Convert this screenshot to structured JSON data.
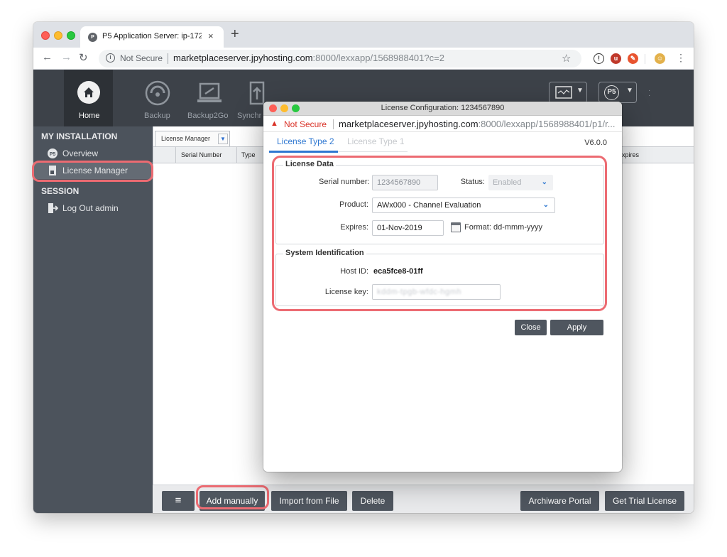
{
  "browser": {
    "tab_title": "P5 Application Server: ip-172-3",
    "tab_close": "×",
    "new_tab": "+",
    "security_label": "Not Secure",
    "url_host": "marketplaceserver.jpyhosting.com",
    "url_rest": ":8000/lexxapp/1568988401?c=2"
  },
  "header": {
    "home_label": "Home",
    "nav_items": [
      "Backup",
      "Backup2Go",
      "Synchr"
    ],
    "p5_label": "P5"
  },
  "sidebar": {
    "section_installation": "MY INSTALLATION",
    "overview_label": "Overview",
    "license_manager_label": "License Manager",
    "section_session": "SESSION",
    "logout_label": "Log Out admin"
  },
  "license_manager": {
    "tab_label": "License Manager",
    "columns": [
      "Serial Number",
      "Type",
      "xpires"
    ]
  },
  "bottom_bar": {
    "menu_label": "≡",
    "add_manually": "Add manually",
    "import_from_file": "Import from File",
    "delete": "Delete",
    "archiware_portal": "Archiware Portal",
    "get_trial_license": "Get Trial License"
  },
  "dialog": {
    "title": "License Configuration: 1234567890",
    "security_label": "Not Secure",
    "url_host": "marketplaceserver.jpyhosting.com",
    "url_rest": ":8000/lexxapp/1568988401/p1/r...",
    "tab_active": "License Type 2",
    "tab_inactive": "License Type 1",
    "version": "V6.0.0",
    "license_data": {
      "legend": "License Data",
      "serial_label": "Serial number:",
      "serial_value": "1234567890",
      "status_label": "Status:",
      "status_value": "Enabled",
      "product_label": "Product:",
      "product_value": "AWx000 - Channel Evaluation",
      "expires_label": "Expires:",
      "expires_value": "01-Nov-2019",
      "format_text": "Format: dd-mmm-yyyy"
    },
    "system_identification": {
      "legend": "System Identification",
      "host_id_label": "Host ID:",
      "host_id_value": "eca5fce8-01ff",
      "license_key_label": "License key:",
      "license_key_value": "kddm-tpgb-wfdc-hgmh"
    },
    "close_label": "Close",
    "apply_label": "Apply"
  },
  "colors": {
    "header_bg": "#3d4249",
    "sidebar_bg": "#4c535c",
    "accent_blue": "#2f78d1",
    "highlight_ring": "#ec6b72",
    "button_bg": "#4f565f"
  }
}
